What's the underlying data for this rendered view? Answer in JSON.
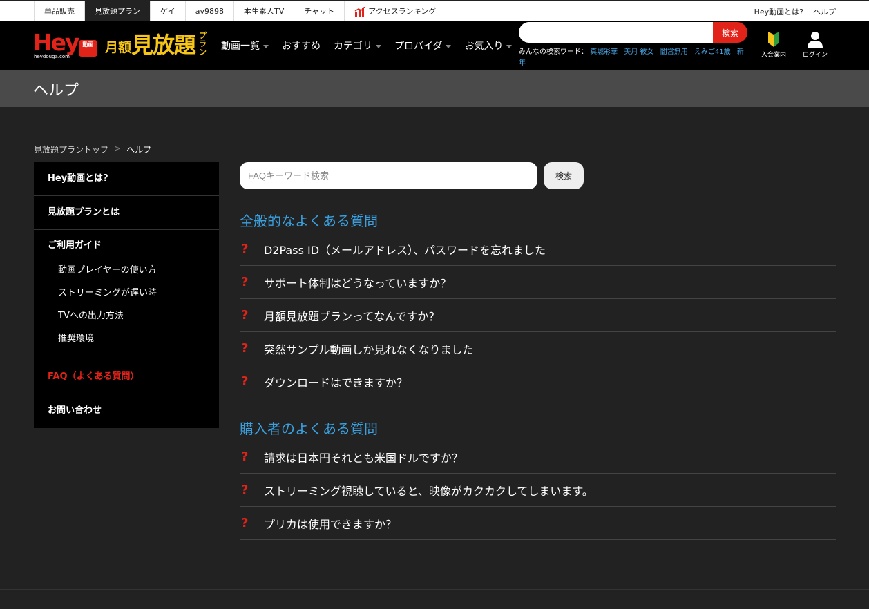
{
  "topbar": {
    "links": [
      {
        "label": "単品販売",
        "active": false
      },
      {
        "label": "見放題プラン",
        "active": true
      },
      {
        "label": "ゲイ",
        "active": false
      },
      {
        "label": "av9898",
        "active": false
      },
      {
        "label": "本生素人TV",
        "active": false
      },
      {
        "label": "チャット",
        "active": false
      },
      {
        "label": "アクセスランキング",
        "active": false,
        "icon": "ranking-chart-icon"
      }
    ],
    "right": [
      "Hey動画とは?",
      "ヘルプ"
    ]
  },
  "header": {
    "logo": {
      "hey": "Hey",
      "badge": "動画",
      "domain": "heydouga.com",
      "plan_small": "月額",
      "plan_big": "見放題",
      "plan_tiny": "プラン"
    },
    "nav": [
      {
        "label": "動画一覧",
        "caret": true
      },
      {
        "label": "おすすめ",
        "caret": false
      },
      {
        "label": "カテゴリ",
        "caret": true
      },
      {
        "label": "プロバイダ",
        "caret": true
      },
      {
        "label": "お気入り",
        "caret": true
      }
    ],
    "search": {
      "placeholder": "",
      "button": "検索"
    },
    "keywords_label": "みんなの検索ワード：",
    "keywords": [
      "真城彩華",
      "美月 彼女",
      "闇営無用",
      "えみご41歳",
      "新年"
    ],
    "guide_label": "入会案内",
    "login_label": "ログイン",
    "colors": {
      "accent": "#e2231a",
      "gold": "#f5c518",
      "link": "#4aa8e8"
    }
  },
  "page_title": "ヘルプ",
  "breadcrumb": {
    "home": "見放題プラントップ",
    "sep": ">",
    "current": "ヘルプ"
  },
  "sidebar": {
    "item_about": "Hey動画とは?",
    "item_plan": "見放題プランとは",
    "guide_head": "ご利用ガイド",
    "guide_subs": [
      "動画プレイヤーの使い方",
      "ストリーミングが遅い時",
      "TVへの出力方法",
      "推奨環境"
    ],
    "item_faq": "FAQ（よくある質問）",
    "item_contact": "お問い合わせ"
  },
  "faq_search": {
    "placeholder": "FAQキーワード検索",
    "button": "検索"
  },
  "sections": [
    {
      "title": "全般的なよくある質問",
      "items": [
        "D2Pass ID（メールアドレス）、パスワードを忘れました",
        "サポート体制はどうなっていますか？",
        "月額見放題プランってなんですか？",
        "突然サンプル動画しか見れなくなりました",
        "ダウンロードはできますか？"
      ]
    },
    {
      "title": "購入者のよくある質問",
      "items": [
        "請求は日本円それとも米国ドルですか？",
        "ストリーミング視聴していると、映像がカクカクしてしまいます。",
        "プリカは使用できますか？"
      ]
    }
  ],
  "question_mark": "?"
}
